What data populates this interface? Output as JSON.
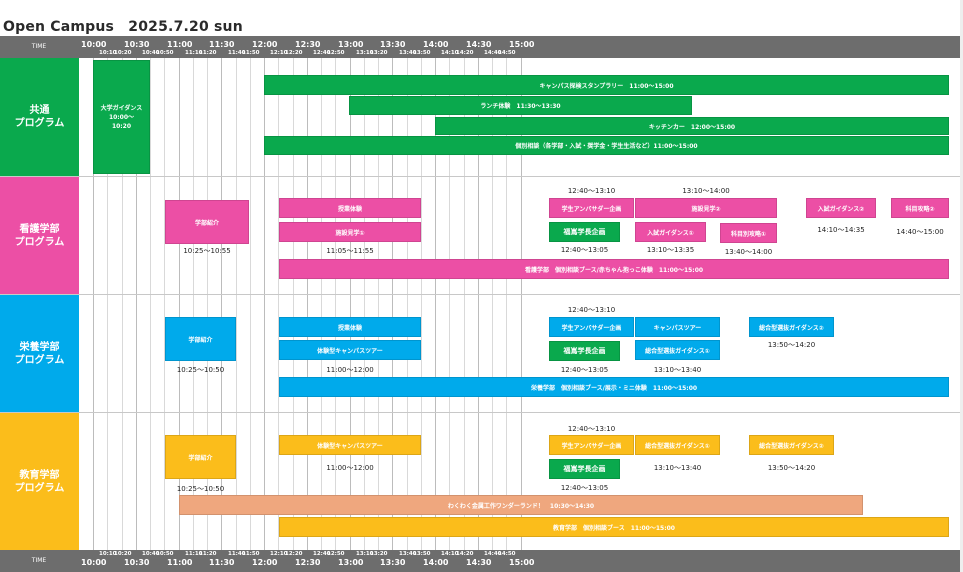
{
  "title": "Open Campus　2025.7.20 sun",
  "time_label": "TIME",
  "ticks": {
    "hours": [
      "10:00",
      "10:30",
      "11:00",
      "11:30",
      "12:00",
      "12:30",
      "13:00",
      "13:30",
      "14:00",
      "14:30",
      "15:00"
    ],
    "tens": [
      "10:10",
      "10:20",
      "10:40",
      "10:50",
      "11:10",
      "11:20",
      "11:40",
      "11:50",
      "12:10",
      "12:20",
      "12:40",
      "12:50",
      "13:10",
      "13:20",
      "13:40",
      "13:50",
      "14:10",
      "14:20",
      "14:40",
      "14:50"
    ]
  },
  "colors": {
    "green": "#0aa94d",
    "pink": "#ec4fa5",
    "blue": "#00aaeb",
    "yellow": "#fbbd1b",
    "peach": "#efa77e"
  },
  "sections": {
    "common": {
      "line1": "共通",
      "line2": "プログラム"
    },
    "nursing": {
      "line1": "看護学部",
      "line2": "プログラム"
    },
    "nutrition": {
      "line1": "栄養学部",
      "line2": "プログラム"
    },
    "education": {
      "line1": "教育学部",
      "line2": "プログラム"
    }
  },
  "common": {
    "guidance": "大学ガイダンス 10:00～10:20",
    "stamp_rally": "キャンパス探検スタンプラリー　11:00～15:00",
    "lunch": "ランチ体験　11:30～13:30",
    "kitchen_car": "キッチンカー　12:00～15:00",
    "consultation": "個別相談（各学部・入試・奨学金・学生生活など）11:00～15:00"
  },
  "nursing": {
    "intro": "学部紹介",
    "intro_time": "10:25～10:55",
    "class": "授業体験",
    "tour1": "施設見学①",
    "class_time": "11:05～11:55",
    "ambassador_time": "12:40～13:10",
    "ambassador": "学生アンバサダー企画",
    "fukuma": "福嶌学長企画",
    "fukuma_time": "12:40～13:05",
    "tour2_time": "13:10～14:00",
    "tour2": "施設見学②",
    "admission1": "入試ガイダンス①",
    "admission1_time": "13:10～13:35",
    "subject1": "科目別攻略①",
    "subject1_time": "13:40～14:00",
    "admission2": "入試ガイダンス②",
    "admission2_time": "14:10～14:35",
    "subject2": "科目攻略②",
    "subject2_time": "14:40～15:00",
    "booth": "看護学部　個別相談ブース/赤ちゃん抱っこ体験　11:00～15:00"
  },
  "nutrition": {
    "intro": "学部紹介",
    "intro_time": "10:25～10:50",
    "class": "授業体験",
    "tour": "体験型キャンパスツアー",
    "class_time": "11:00～12:00",
    "ambassador_time": "12:40～13:10",
    "ambassador": "学生アンバサダー企画",
    "fukuma": "福嶌学長企画",
    "fukuma_time": "12:40～13:05",
    "campus_tour": "キャンパスツアー",
    "comprehensive1": "総合型選抜ガイダンス①",
    "comprehensive1_time": "13:10～13:40",
    "comprehensive2": "総合型選抜ガイダンス②",
    "comprehensive2_time": "13:50～14:20",
    "booth": "栄養学部　個別相談ブース/展示・ミニ体験　11:00～15:00"
  },
  "education": {
    "intro": "学部紹介",
    "intro_time": "10:25～10:50",
    "tour": "体験型キャンパスツアー",
    "tour_time": "11:00～12:00",
    "ambassador_time": "12:40～13:10",
    "ambassador": "学生アンバサダー企画",
    "fukuma": "福嶌学長企画",
    "fukuma_time": "12:40～13:05",
    "comprehensive1": "総合型選抜ガイダンス①",
    "comprehensive1_time": "13:10～13:40",
    "comprehensive2": "総合型選抜ガイダンス②",
    "comprehensive2_time": "13:50～14:20",
    "wonderland": "わくわく金属工作ワンダーランド！　10:30～14:30",
    "booth": "教育学部　個別相談ブース　11:00～15:00"
  }
}
